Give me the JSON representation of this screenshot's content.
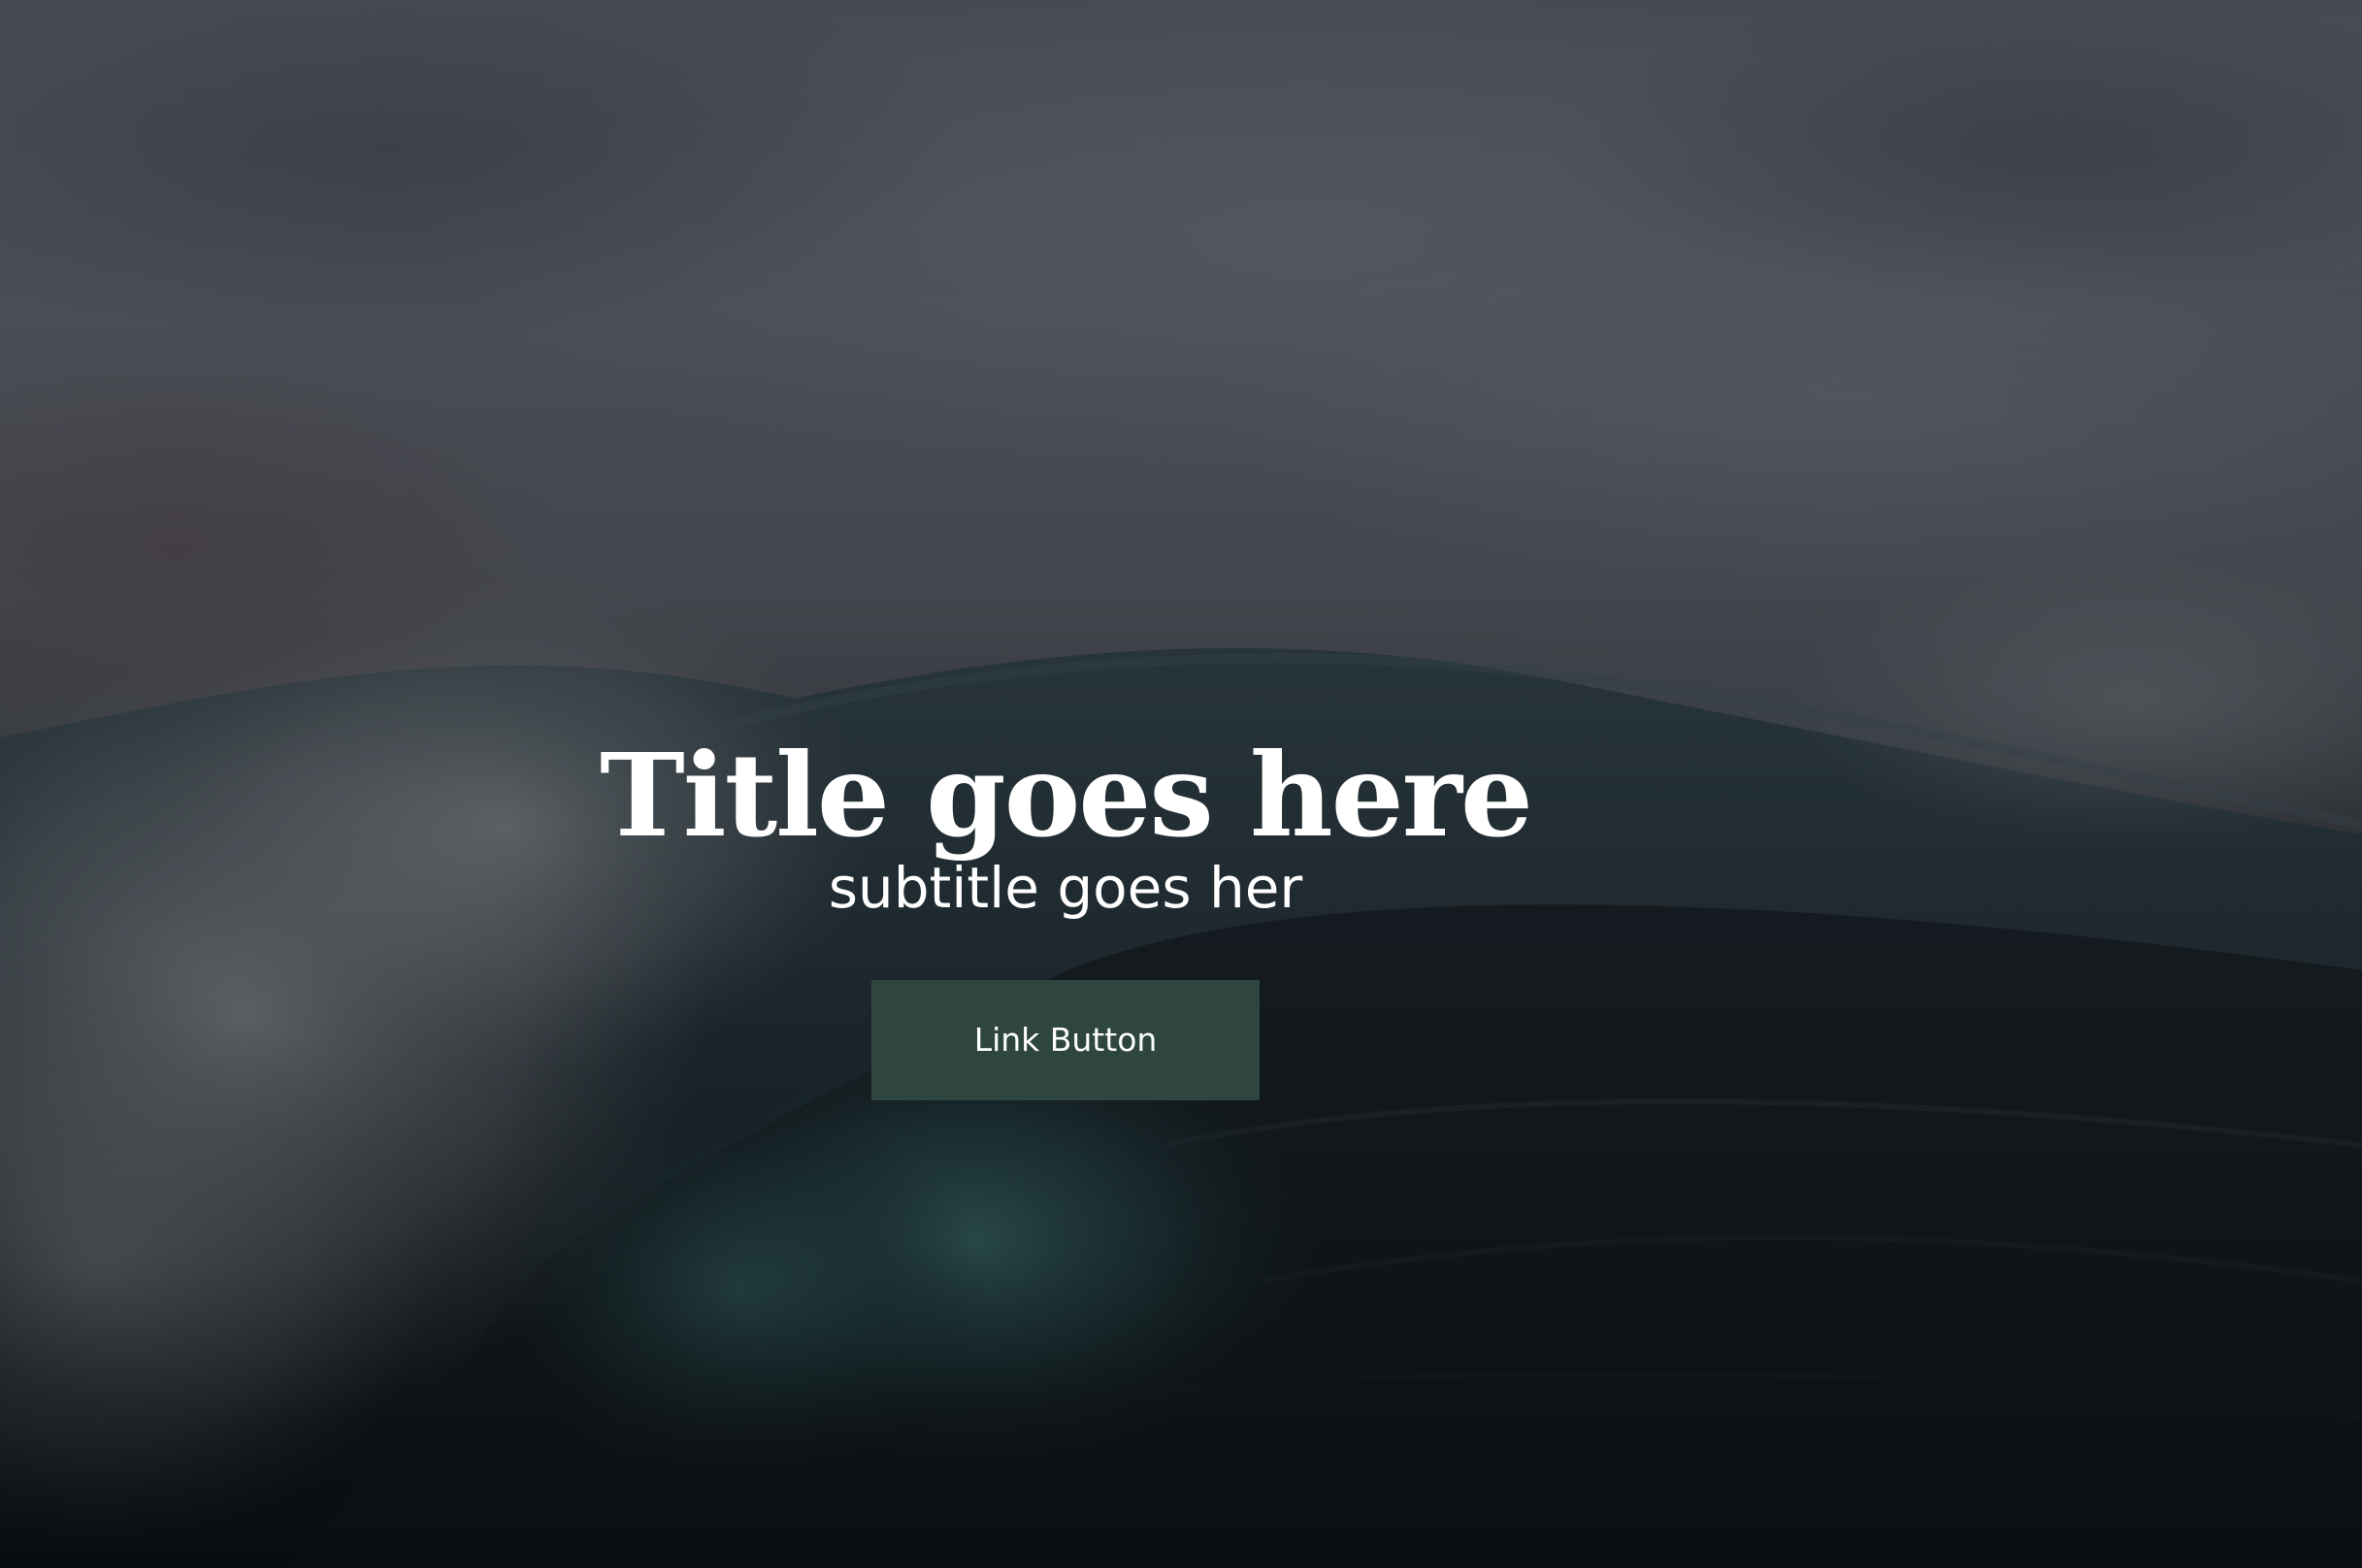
{
  "hero": {
    "title": "Title goes here",
    "subtitle": "subtitle goes her",
    "button_label": "Link Button"
  },
  "colors": {
    "button_background": "#2e4540",
    "text": "#ffffff",
    "sky": "#4e525a",
    "sea": "#1f2a30",
    "wave_highlight": "#2f5a5e"
  }
}
